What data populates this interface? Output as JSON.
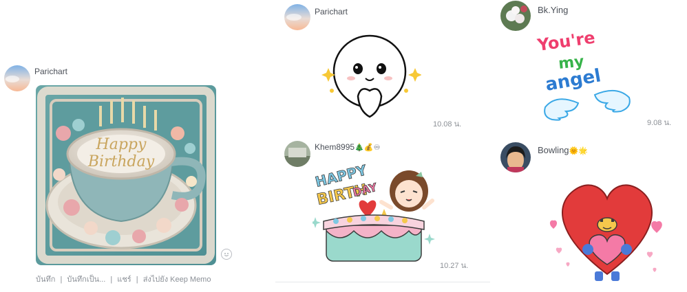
{
  "messages": [
    {
      "id": "parichart-photo",
      "sender": "Parichart",
      "image_text": [
        "Happy",
        "Birthday"
      ],
      "actions": [
        "บันทึก",
        "บันทึกเป็น...",
        "แชร์",
        "ส่งไปยัง Keep Memo"
      ],
      "separator": "|"
    },
    {
      "id": "parichart-sticker",
      "sender": "Parichart",
      "time": "10.08 น."
    },
    {
      "id": "khem-sticker",
      "sender": "Khem8995",
      "sender_emojis": "🎄💰♾",
      "sticker_text": [
        "HAPPY",
        "BIRTH",
        "DAY"
      ],
      "time": "10.27 น."
    },
    {
      "id": "bkying-sticker",
      "sender": "Bk.Ying",
      "sticker_text": [
        "You're",
        "my",
        "angel"
      ],
      "time": "9.08 น."
    },
    {
      "id": "bowling-sticker",
      "sender": "Bowling",
      "sender_emojis": "🌞🌟"
    }
  ],
  "colors": {
    "name": "#4a4f57",
    "time": "#8c9096",
    "heart_red": "#e23b3b",
    "pink": "#f47aa6",
    "mint": "#9ad9cc"
  }
}
